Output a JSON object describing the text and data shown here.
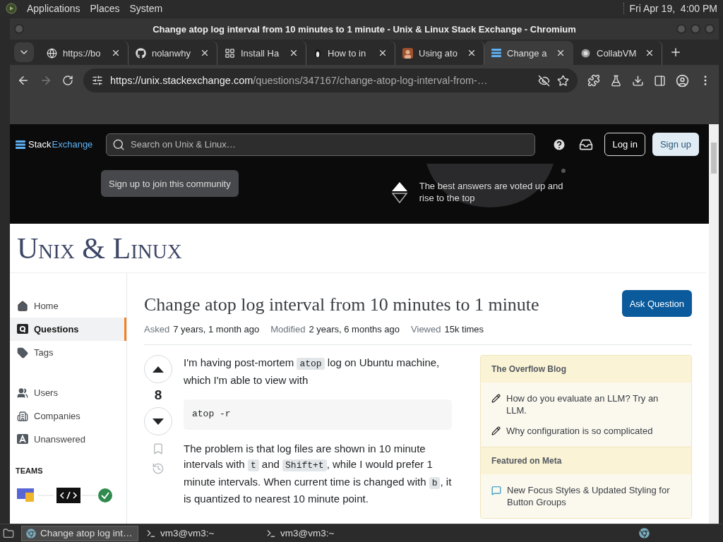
{
  "desktop_panel": {
    "menus": [
      "Applications",
      "Places",
      "System"
    ],
    "clock": "Fri Apr 19,  4:00 PM"
  },
  "window": {
    "title": "Change atop log interval from 10 minutes to 1 minute - Unix & Linux Stack Exchange - Chromium"
  },
  "tabs": [
    {
      "label": "https://bo",
      "kind": "globe",
      "selected": false
    },
    {
      "label": "nolanwhy",
      "kind": "github",
      "selected": false
    },
    {
      "label": "Install Ha",
      "kind": "apps",
      "selected": false
    },
    {
      "label": "How to in",
      "kind": "penguin",
      "selected": false
    },
    {
      "label": "Using ato",
      "kind": "avatar",
      "selected": false
    },
    {
      "label": "Change a",
      "kind": "stackexchange",
      "selected": true
    },
    {
      "label": "CollabVM",
      "kind": "collab",
      "selected": false
    }
  ],
  "address_bar": {
    "host": "https://unix.stackexchange.com",
    "path": "/questions/347167/change-atop-log-interval-from-…"
  },
  "site_header": {
    "logo_parts": [
      "Stack",
      "Exchange"
    ],
    "search_placeholder": "Search on Unix & Linux…",
    "login": "Log in",
    "signup": "Sign up",
    "join": "Sign up to join this community",
    "promo": "The best answers are voted up and rise to the top"
  },
  "site_name": "Unix & Linux",
  "nav": [
    {
      "label": "Home",
      "kind": "home",
      "selected": false
    },
    {
      "label": "Questions",
      "kind": "questions",
      "selected": true
    },
    {
      "label": "Tags",
      "kind": "tags",
      "selected": false
    },
    {
      "label": "Users",
      "kind": "users",
      "selected": false
    },
    {
      "label": "Companies",
      "kind": "companies",
      "selected": false
    },
    {
      "label": "Unanswered",
      "kind": "unanswered",
      "selected": false
    }
  ],
  "teams_heading": "TEAMS",
  "question": {
    "title": "Change atop log interval from 10 minutes to 1 minute",
    "ask_button": "Ask Question",
    "meta": [
      {
        "label": "Asked",
        "value": "7 years, 1 month ago"
      },
      {
        "label": "Modified",
        "value": "2 years, 6 months ago"
      },
      {
        "label": "Viewed",
        "value": "15k times"
      }
    ],
    "score": "8",
    "body": [
      {
        "kind": "paragraph",
        "parts": [
          {
            "kind": "text",
            "text": "I'm having post-mortem "
          },
          {
            "kind": "code",
            "text": "atop"
          },
          {
            "kind": "text",
            "text": " log on Ubuntu machine, which I'm able to view with"
          }
        ]
      },
      {
        "kind": "codeblock",
        "parts": [
          {
            "kind": "text",
            "text": "atop -r"
          }
        ]
      },
      {
        "kind": "paragraph",
        "parts": [
          {
            "kind": "text",
            "text": "The problem is that log files are shown in 10 minute intervals with "
          },
          {
            "kind": "code",
            "text": "t"
          },
          {
            "kind": "text",
            "text": " and "
          },
          {
            "kind": "code",
            "text": "Shift+t"
          },
          {
            "kind": "text",
            "text": ", while I would prefer 1 minute intervals. When current time is changed with "
          },
          {
            "kind": "code",
            "text": "b"
          },
          {
            "kind": "text",
            "text": ", it is quantized to nearest 10 minute point."
          }
        ]
      }
    ]
  },
  "widget": [
    {
      "heading": "The Overflow Blog",
      "items": [
        {
          "kind": "pencil",
          "text": "How do you evaluate an LLM? Try an LLM."
        },
        {
          "kind": "pencil",
          "text": "Why configuration is so complicated"
        }
      ]
    },
    {
      "heading": "Featured on Meta",
      "items": [
        {
          "kind": "meta",
          "text": "New Focus Styles & Updated Styling for Button Groups"
        }
      ]
    }
  ],
  "taskbar": [
    {
      "label": "Change atop log int…",
      "kind": "browser",
      "selected": true
    },
    {
      "label": "vm3@vm3:~",
      "kind": "terminal",
      "selected": false
    },
    {
      "label": "vm3@vm3:~",
      "kind": "terminal",
      "selected": false
    }
  ]
}
